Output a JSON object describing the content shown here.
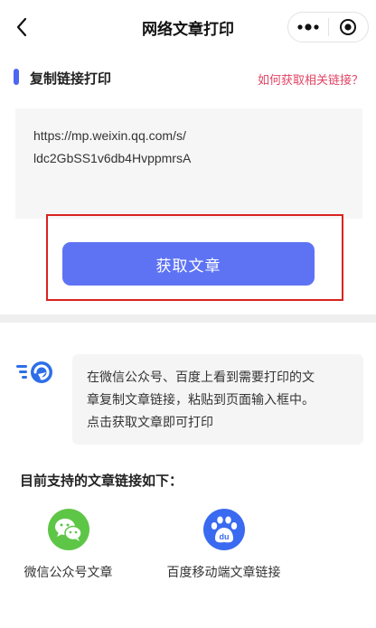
{
  "nav": {
    "title": "网络文章打印",
    "back_icon": "chevron-left-icon",
    "more_icon": "more-dots-icon",
    "close_icon": "record-circle-icon"
  },
  "section": {
    "title": "复制链接打印",
    "help_link": "如何获取相关链接？",
    "accent": "#4d67f0",
    "link_color": "#e24464"
  },
  "input": {
    "lines": [
      "https://mp.weixin.qq.com/s/",
      "ldc2GbSS1v6db4HvppmrsA"
    ]
  },
  "fetch_button": {
    "label": "获取文章",
    "color": "#5e73f4",
    "highlight_color": "#d8231f"
  },
  "tip": {
    "icon": "speed-arrow-icon",
    "lines": [
      "在微信公众号、百度上看到需要打印的文",
      "章复制文章链接，粘贴到页面输入框中。",
      "点击获取文章即可打印"
    ]
  },
  "supported": {
    "title": "目前支持的文章链接如下：",
    "items": [
      {
        "label": "微信公众号文章",
        "icon": "wechat-icon",
        "color": "#5ec646"
      },
      {
        "label": "百度移动端文章链接",
        "icon": "baidu-paw-icon",
        "color": "#3a6af0"
      }
    ]
  }
}
